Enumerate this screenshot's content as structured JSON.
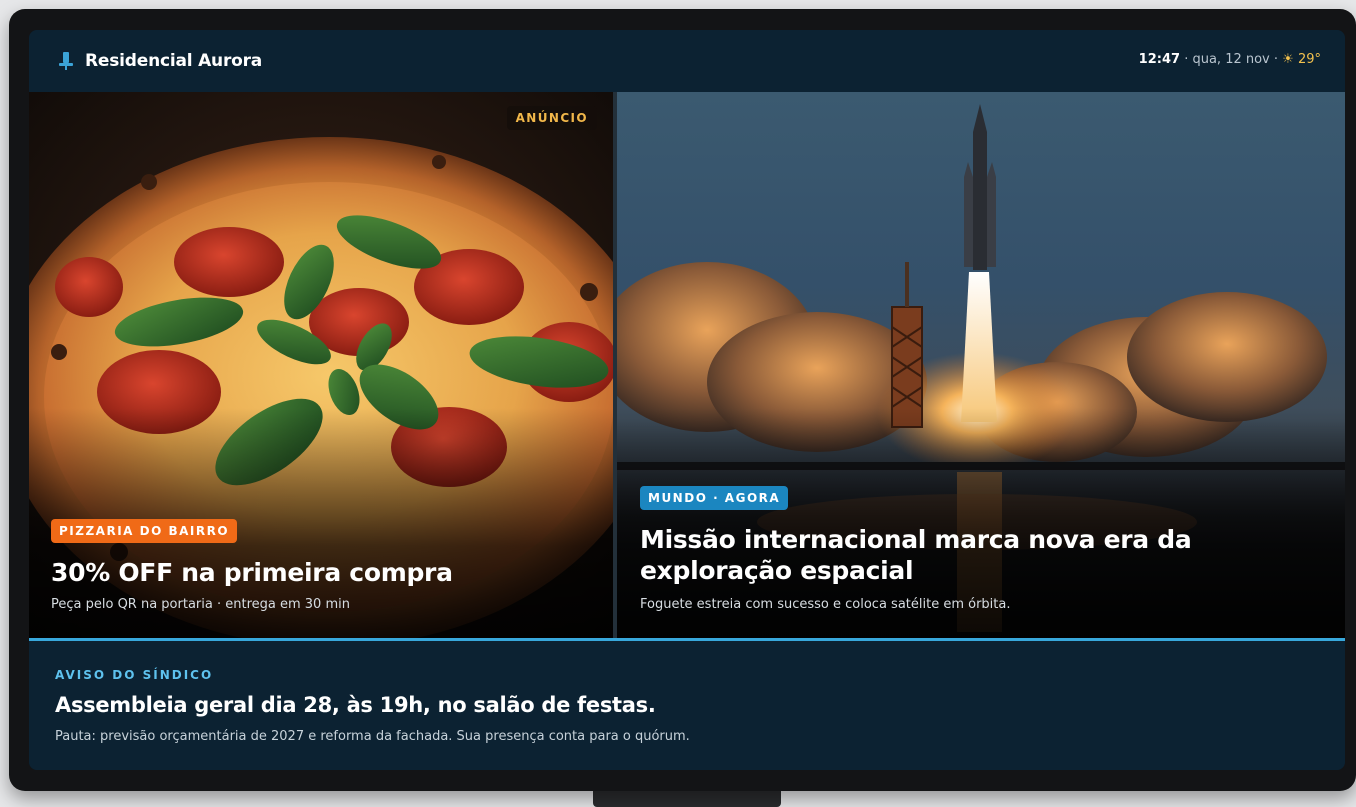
{
  "header": {
    "building_name": "Residencial Aurora",
    "time": "12:47",
    "date": "· qua, 12 nov ·",
    "weather_icon": "sun-icon",
    "temperature": "29°"
  },
  "ad": {
    "tag": "ANÚNCIO",
    "badge": "PIZZARIA DO BAIRRO",
    "headline": "30% OFF na primeira compra",
    "subtext": "Peça pelo QR na portaria · entrega em 30 min"
  },
  "news": {
    "badge": "MUNDO · AGORA",
    "headline": "Missão internacional marca nova era da exploração espacial",
    "subtext": "Foguete estreia com sucesso e coloca satélite em órbita."
  },
  "notice": {
    "label": "AVISO DO SÍNDICO",
    "title": "Assembleia geral dia 28, às 19h, no salão de festas.",
    "text": "Pauta: previsão orçamentária de 2027 e reforma da fachada. Sua presença conta para o quórum."
  },
  "colors": {
    "accent": "#38a8dc",
    "ad_badge": "#f06a17",
    "news_badge": "#1b86c0",
    "ad_tag": "#f1b74a",
    "header_bg": "#0c2232"
  }
}
